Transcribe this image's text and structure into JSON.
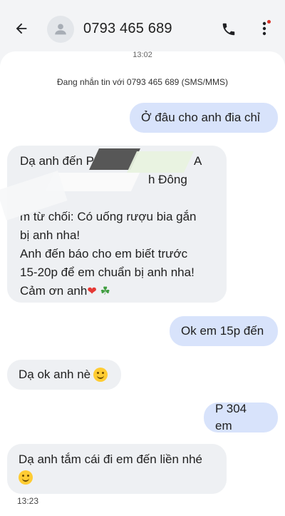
{
  "header": {
    "back_icon": "arrow-left-icon",
    "avatar_icon": "person-icon",
    "title": "0793 465 689",
    "call_icon": "phone-icon",
    "more_icon": "more-vert-icon",
    "notification_color": "#d93025"
  },
  "thread": {
    "top_timestamp": "13:02",
    "info": "Đang nhắn tin với 0793 465 689 (SMS/MMS)",
    "messages": [
      {
        "direction": "outgoing",
        "text": "Ở đâu cho anh đia chỉ"
      },
      {
        "direction": "incoming",
        "lines": [
          "Dạ anh đến P",
          "A",
          "h Đông",
          "m từ chối: Có uống rượu bia gắn",
          "bị anh nha!",
          "Anh đến báo cho em biết trước",
          "15-20p để em chuẩn bị anh nha!",
          "Cảm ơn anh"
        ]
      },
      {
        "direction": "outgoing",
        "text": "Ok em 15p đến"
      },
      {
        "direction": "incoming",
        "text": "Dạ ok anh nè"
      },
      {
        "direction": "outgoing",
        "text": "P 304 em"
      },
      {
        "direction": "incoming",
        "text": "Dạ anh tắm cái đi em đến liền nhé"
      }
    ],
    "bottom_timestamp": "13:23"
  },
  "colors": {
    "outgoing_bubble": "#d8e3fb",
    "incoming_bubble": "#eef0f3",
    "background": "#f3f4f6"
  }
}
